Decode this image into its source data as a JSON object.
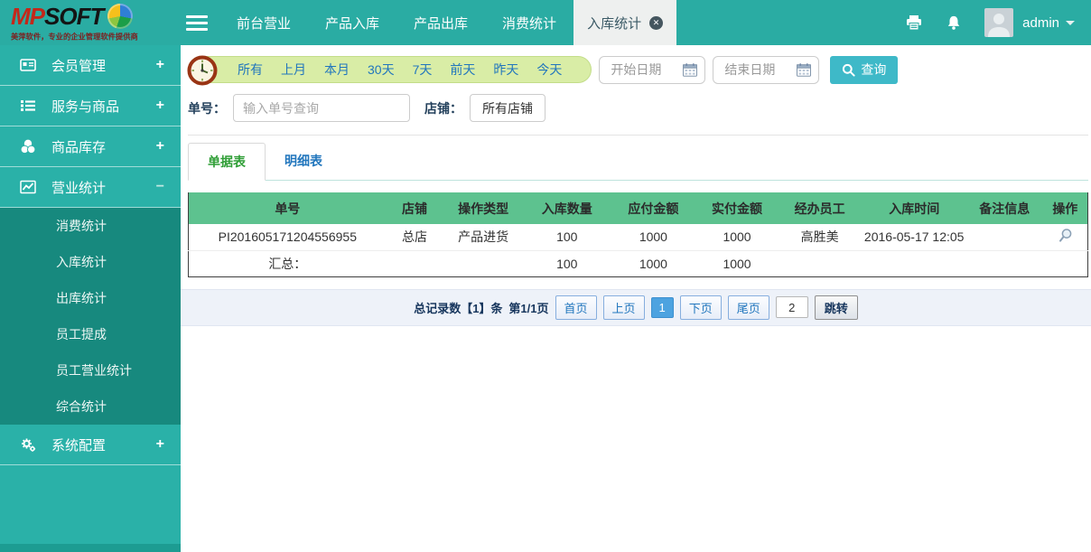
{
  "colors": {
    "navbar_teal": "#2aaca3",
    "sidebar_teal": "#2ab1a8",
    "submenu_teal": "#17897e",
    "table_header_green": "#5dc28f",
    "value_red": "#e80f0f",
    "link_blue": "#2176bd",
    "active_tab_green": "#2f9e36",
    "query_button_teal": "#3eb9c8",
    "quickbar_green": "#d9eda6",
    "pagination_active_blue": "#4da3e0"
  },
  "brand": {
    "logo_mp": "MP",
    "logo_soft": "SOFT",
    "tagline": "美萍软件，专业的企业管理软件提供商"
  },
  "navbar": {
    "items": [
      "前台营业",
      "产品入库",
      "产品出库",
      "消费统计"
    ],
    "active_tab": "入库统计",
    "close_glyph": "✕",
    "username": "admin"
  },
  "sidebar": {
    "items": [
      {
        "label": "会员管理",
        "toggle": "+"
      },
      {
        "label": "服务与商品",
        "toggle": "+"
      },
      {
        "label": "商品库存",
        "toggle": "+"
      },
      {
        "label": "营业统计",
        "toggle": "−"
      },
      {
        "label": "系统配置",
        "toggle": "+"
      }
    ],
    "submenu": [
      "消费统计",
      "入库统计",
      "出库统计",
      "员工提成",
      "员工营业统计",
      "综合统计"
    ]
  },
  "filters": {
    "quick_ranges": [
      "所有",
      "上月",
      "本月",
      "30天",
      "7天",
      "前天",
      "昨天",
      "今天"
    ],
    "start_date_placeholder": "开始日期",
    "end_date_placeholder": "结束日期",
    "query_button": "查询",
    "order_no_label": "单号：",
    "order_no_placeholder": "输入单号查询",
    "store_label": "店铺：",
    "store_button": "所有店铺"
  },
  "tabs": {
    "active": "单据表",
    "inactive": "明细表"
  },
  "table": {
    "headers": [
      "单号",
      "店铺",
      "操作类型",
      "入库数量",
      "应付金额",
      "实付金额",
      "经办员工",
      "入库时间",
      "备注信息",
      "操作"
    ],
    "row": {
      "order_no": "PI201605171204556955",
      "store": "总店",
      "op_type": "产品进货",
      "qty": "100",
      "payable": "1000",
      "paid": "1000",
      "staff": "高胜美",
      "time": "2016-05-17 12:05",
      "note": ""
    },
    "summary": {
      "label": "汇总：",
      "qty": "100",
      "payable": "1000",
      "paid": "1000"
    }
  },
  "pagination": {
    "total_text": "总记录数【1】条",
    "page_text": "第1/1页",
    "first": "首页",
    "prev": "上页",
    "current": "1",
    "next": "下页",
    "last": "尾页",
    "jump_value": "2",
    "jump_button": "跳转"
  }
}
